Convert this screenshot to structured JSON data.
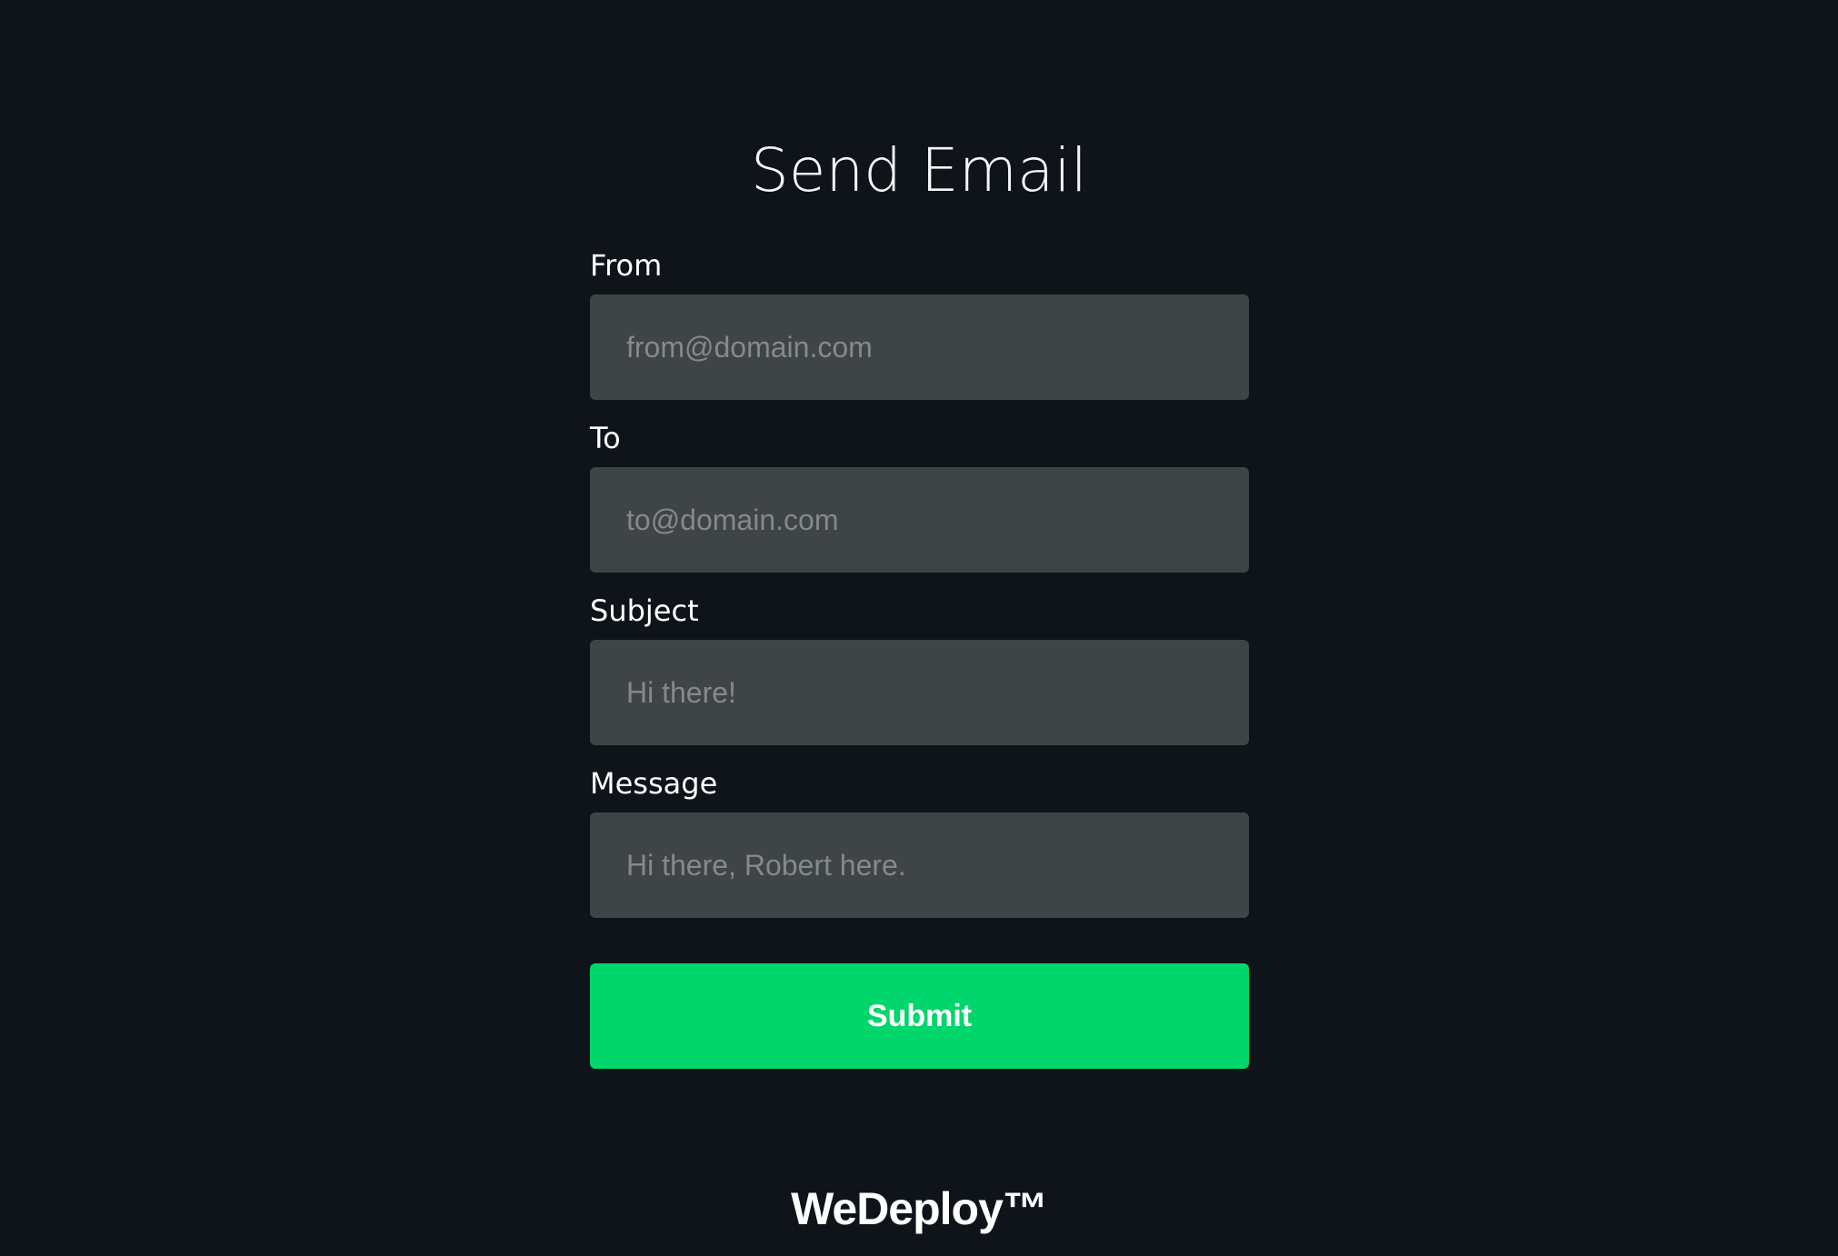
{
  "page": {
    "title": "Send Email"
  },
  "form": {
    "from": {
      "label": "From",
      "placeholder": "from@domain.com"
    },
    "to": {
      "label": "To",
      "placeholder": "to@domain.com"
    },
    "subject": {
      "label": "Subject",
      "placeholder": "Hi there!"
    },
    "message": {
      "label": "Message",
      "placeholder": "Hi there, Robert here."
    },
    "submit_label": "Submit"
  },
  "footer": {
    "logo_text": "WeDeploy™"
  },
  "colors": {
    "background": "#0f141b",
    "input_background": "#3f4447",
    "accent": "#00d66b"
  }
}
